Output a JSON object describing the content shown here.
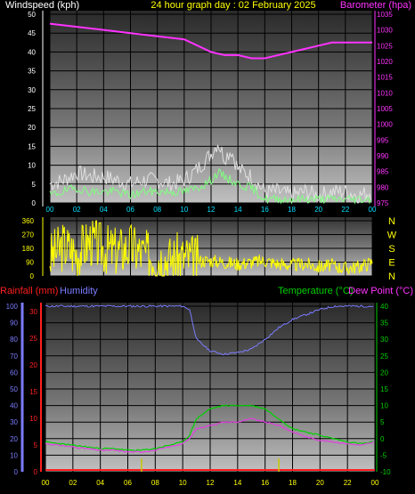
{
  "header": {
    "left_label": "Windspeed (kph)",
    "title": "24 hour graph day : 02 February 2025",
    "right_label": "Barometer (hpa)"
  },
  "colors": {
    "background": "#000000",
    "wind_gust": "#e0e0e0",
    "wind_avg": "#80ff80",
    "barometer": "#ff33ff",
    "wind_dir": "#ffff00",
    "rain_axis": "#ff2020",
    "humidity": "#7b7bff",
    "temperature": "#00d000",
    "dewpoint": "#e040e0",
    "rain_bars": "#c8c800",
    "grid": "#000000"
  },
  "x_ticks": [
    "00",
    "02",
    "04",
    "06",
    "08",
    "10",
    "12",
    "14",
    "16",
    "18",
    "20",
    "22",
    "00"
  ],
  "panel1": {
    "wind_ticks": [
      "0",
      "5",
      "10",
      "15",
      "20",
      "25",
      "30",
      "35",
      "40",
      "45",
      "50"
    ],
    "baro_ticks": [
      "975",
      "980",
      "985",
      "990",
      "995",
      "1000",
      "1005",
      "1010",
      "1015",
      "1020",
      "1025",
      "1030",
      "1035"
    ]
  },
  "panel2": {
    "dir_ticks": [
      "0",
      "90",
      "180",
      "270",
      "360"
    ],
    "compass": [
      "N",
      "W",
      "S",
      "E",
      "N"
    ]
  },
  "panel3": {
    "rain_label": "Rainfall (mm)",
    "humidity_label": "Humidity",
    "temp_label": "Temperature (°C)",
    "dew_label": "Dew Point (°C)",
    "humidity_ticks": [
      "0",
      "10",
      "20",
      "30",
      "40",
      "50",
      "60",
      "70",
      "80",
      "90",
      "100"
    ],
    "rain_ticks": [
      "0",
      "5",
      "10",
      "15",
      "20",
      "25",
      "30"
    ],
    "temp_ticks": [
      "-10",
      "-5",
      "0",
      "5",
      "10",
      "15",
      "20",
      "25",
      "30",
      "35",
      "40"
    ]
  },
  "chart_data": [
    {
      "type": "line",
      "x_unit": "hour",
      "xlim": [
        0,
        24
      ],
      "ylim_left": [
        0,
        50
      ],
      "ylim_right": [
        975,
        1035
      ],
      "series": [
        {
          "axis": "left",
          "x": [
            0,
            1,
            2,
            3,
            4,
            5,
            6,
            7,
            8,
            9,
            10,
            11,
            12,
            12.5,
            13,
            13.5,
            14,
            15,
            16,
            17,
            18,
            19,
            20,
            21,
            22,
            23,
            24
          ],
          "values": [
            5,
            6,
            8,
            7,
            7,
            6,
            5,
            6,
            6,
            5,
            6,
            9,
            13,
            16,
            12,
            14,
            9,
            7,
            3,
            3,
            2,
            3,
            2,
            3,
            3,
            2,
            3
          ]
        },
        {
          "axis": "left",
          "x": [
            0,
            1,
            2,
            3,
            4,
            5,
            6,
            7,
            8,
            9,
            10,
            11,
            12,
            12.5,
            13,
            13.5,
            14,
            15,
            16,
            17,
            18,
            19,
            20,
            21,
            22,
            23,
            24
          ],
          "values": [
            2,
            3,
            4,
            3,
            3,
            3,
            2,
            3,
            3,
            3,
            3,
            4,
            6,
            8,
            7,
            6,
            5,
            4,
            1,
            1,
            1,
            1,
            1,
            1,
            1,
            1,
            1
          ]
        },
        {
          "axis": "right",
          "x": [
            0,
            2,
            4,
            6,
            8,
            10,
            11,
            12,
            13,
            14,
            15,
            16,
            17,
            18,
            19,
            20,
            21,
            22,
            23,
            24
          ],
          "values": [
            1032,
            1031,
            1030,
            1029,
            1028,
            1027,
            1025,
            1023,
            1022,
            1022,
            1021,
            1021,
            1022,
            1023,
            1024,
            1025,
            1026,
            1026,
            1026,
            1026
          ]
        }
      ]
    },
    {
      "type": "line",
      "x_unit": "hour",
      "xlim": [
        0,
        24
      ],
      "ylim": [
        0,
        360
      ],
      "series": [
        {
          "x": [
            0,
            1,
            2,
            3,
            4,
            5,
            6,
            7,
            8,
            9,
            10,
            11,
            12,
            13,
            14,
            15,
            16,
            17,
            18,
            19,
            20,
            21,
            22,
            23,
            24
          ],
          "values": [
            120,
            200,
            150,
            230,
            180,
            160,
            190,
            140,
            130,
            110,
            120,
            100,
            100,
            90,
            80,
            90,
            100,
            80,
            70,
            80,
            60,
            70,
            50,
            60,
            90
          ]
        }
      ]
    },
    {
      "type": "line",
      "x_unit": "hour",
      "xlim": [
        0,
        24
      ],
      "ylim_humidity": [
        0,
        100
      ],
      "ylim_rain": [
        0,
        30
      ],
      "ylim_temp": [
        -10,
        40
      ],
      "series": [
        {
          "axis": "humidity",
          "x": [
            0,
            2,
            4,
            6,
            8,
            10,
            10.5,
            11,
            12,
            13,
            14,
            15,
            16,
            17,
            18,
            19,
            20,
            21,
            22,
            23,
            24
          ],
          "values": [
            100,
            100,
            100,
            100,
            100,
            100,
            98,
            80,
            73,
            71,
            72,
            74,
            80,
            87,
            92,
            95,
            98,
            100,
            100,
            100,
            100
          ]
        },
        {
          "axis": "temp",
          "x": [
            0,
            1,
            2,
            3,
            4,
            5,
            6,
            7,
            8,
            9,
            10,
            10.5,
            11,
            12,
            13,
            14,
            15,
            16,
            17,
            18,
            19,
            20,
            21,
            22,
            23,
            24
          ],
          "values": [
            -1,
            -1.5,
            -2,
            -2.5,
            -3,
            -3,
            -3.5,
            -3.5,
            -3,
            -2,
            -1,
            1,
            6,
            9,
            10,
            10,
            10,
            9,
            6,
            3,
            2,
            1,
            0,
            -1,
            -1.5,
            -1
          ]
        },
        {
          "axis": "temp",
          "x": [
            0,
            1,
            2,
            3,
            4,
            5,
            6,
            7,
            8,
            9,
            10,
            10.5,
            11,
            12,
            13,
            14,
            15,
            16,
            17,
            18,
            19,
            20,
            21,
            22,
            23,
            24
          ],
          "values": [
            -1.5,
            -2,
            -2.5,
            -3,
            -3.5,
            -3.5,
            -4,
            -4,
            -3.5,
            -2.5,
            -1.5,
            0,
            3,
            4,
            5,
            5,
            6,
            5,
            4,
            2,
            0.5,
            -0.5,
            -1,
            -1.5,
            -2,
            -1
          ]
        },
        {
          "axis": "rain",
          "type": "bar",
          "x": [
            7,
            17
          ],
          "values": [
            2.5,
            2.5
          ]
        }
      ]
    }
  ]
}
